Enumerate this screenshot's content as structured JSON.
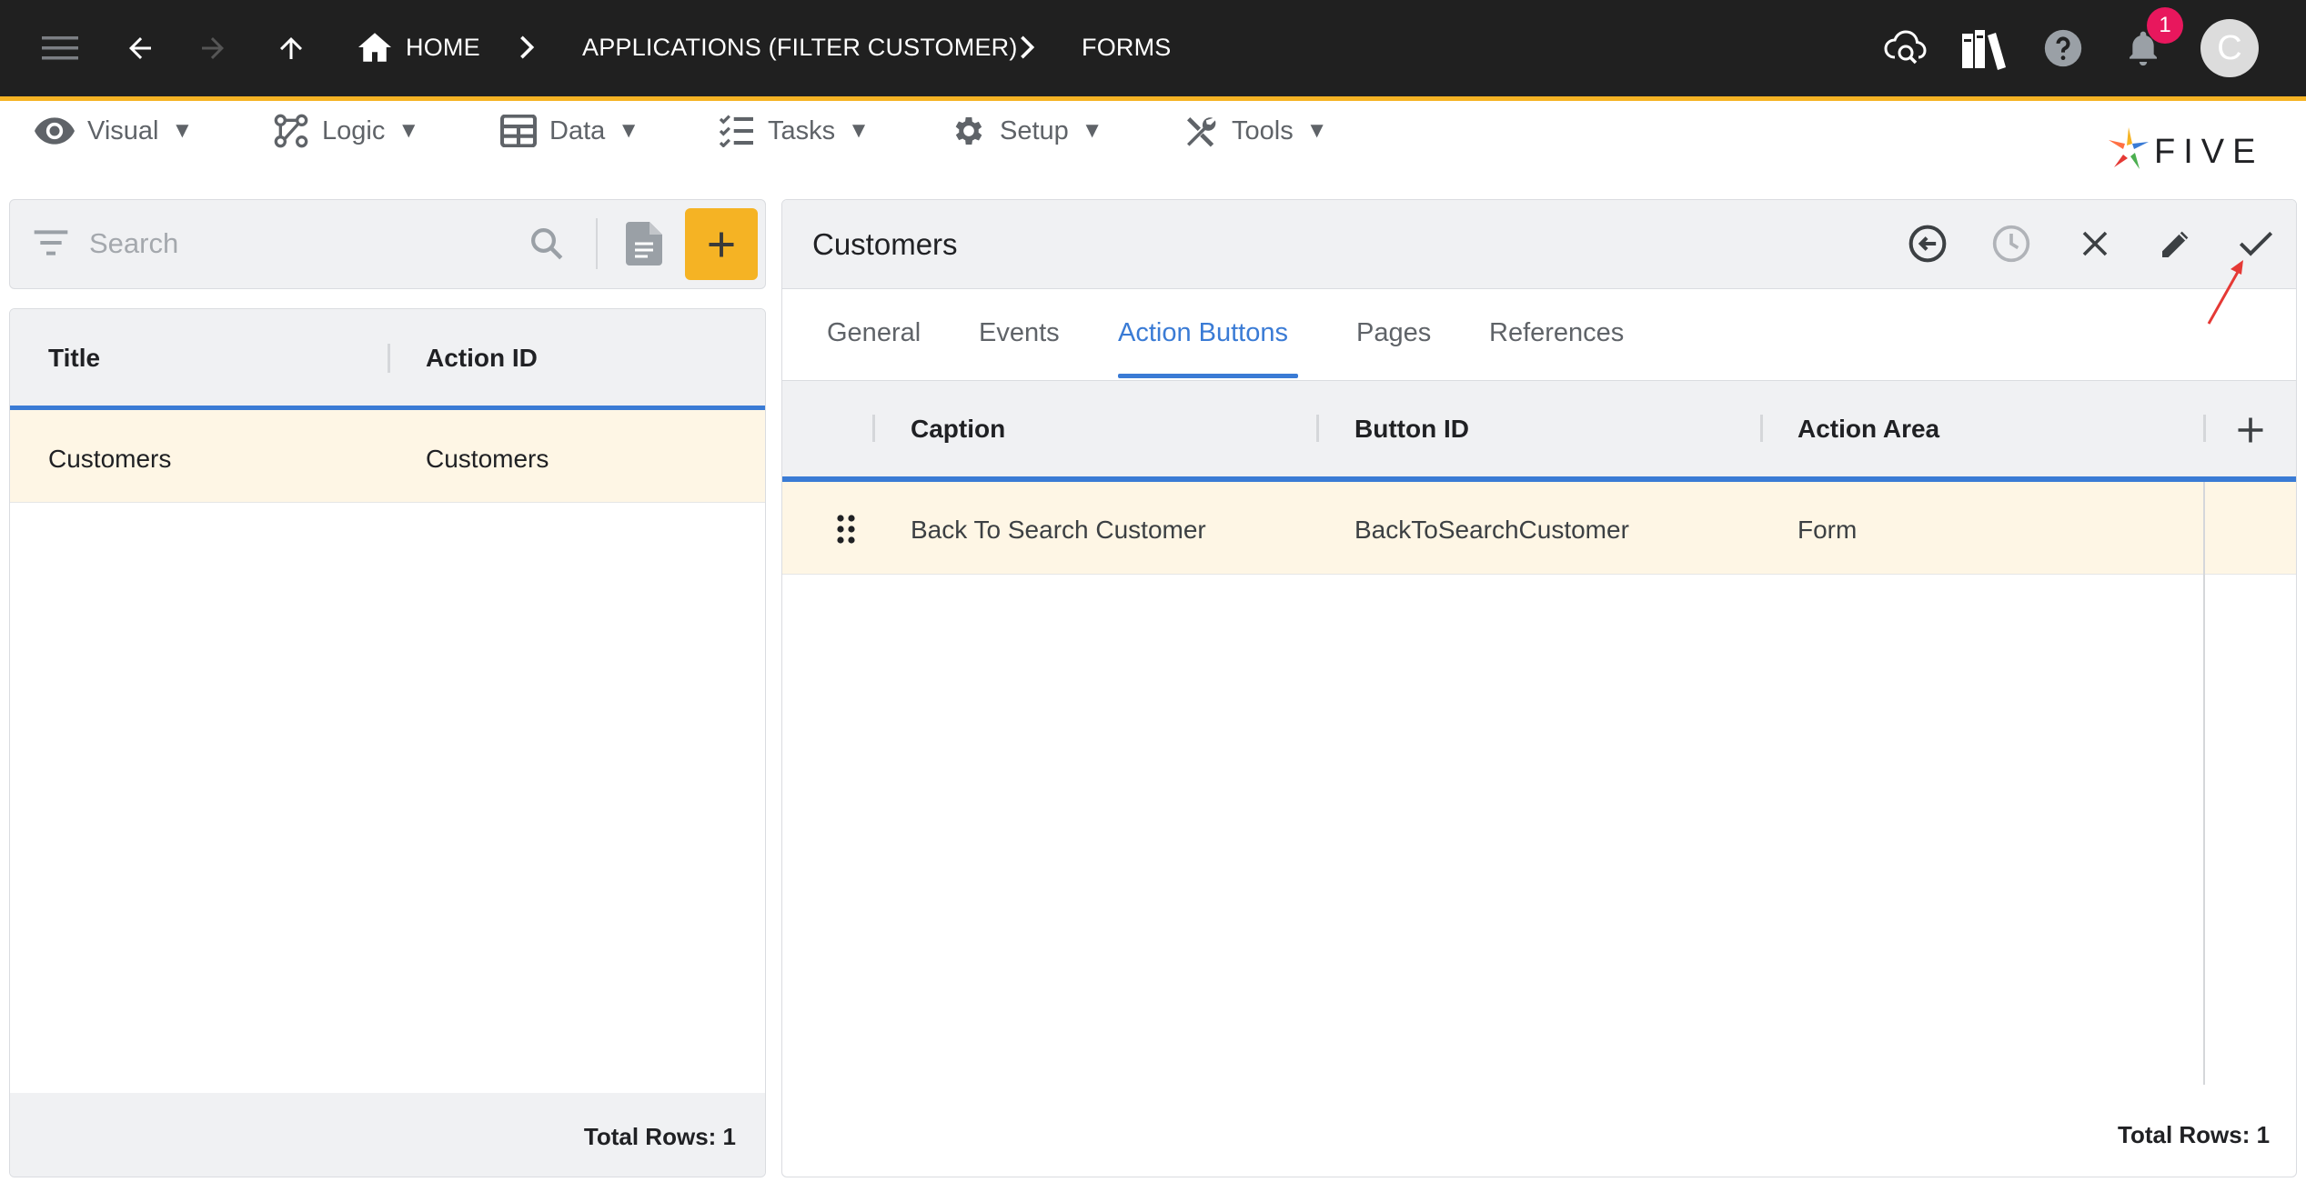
{
  "topbar": {
    "breadcrumbs": [
      "HOME",
      "APPLICATIONS (FILTER CUSTOMER)",
      "FORMS"
    ],
    "notifications_count": "1",
    "avatar_letter": "C"
  },
  "menu": {
    "items": [
      {
        "label": "Visual",
        "icon": "eye-icon"
      },
      {
        "label": "Logic",
        "icon": "logic-icon"
      },
      {
        "label": "Data",
        "icon": "table-icon"
      },
      {
        "label": "Tasks",
        "icon": "checklist-icon"
      },
      {
        "label": "Setup",
        "icon": "gear-icon"
      },
      {
        "label": "Tools",
        "icon": "tools-icon"
      }
    ],
    "caret": "▼",
    "brand": "FIVE"
  },
  "left": {
    "search_placeholder": "Search",
    "columns": [
      "Title",
      "Action ID"
    ],
    "rows": [
      {
        "title": "Customers",
        "action_id": "Customers"
      }
    ],
    "footer": "Total Rows: 1"
  },
  "right": {
    "title": "Customers",
    "tabs": [
      "General",
      "Events",
      "Action Buttons",
      "Pages",
      "References"
    ],
    "active_tab": "Action Buttons",
    "columns": [
      "Caption",
      "Button ID",
      "Action Area"
    ],
    "rows": [
      {
        "caption": "Back To Search Customer",
        "button_id": "BackToSearchCustomer",
        "action_area": "Form"
      }
    ],
    "footer": "Total Rows: 1"
  },
  "colors": {
    "topbar": "#202020",
    "accent": "#f5b324",
    "active_tab": "#3a7bd5",
    "selected_row": "#fef6e5",
    "badge": "#e8175d",
    "annotation_arrow": "#e53935"
  }
}
